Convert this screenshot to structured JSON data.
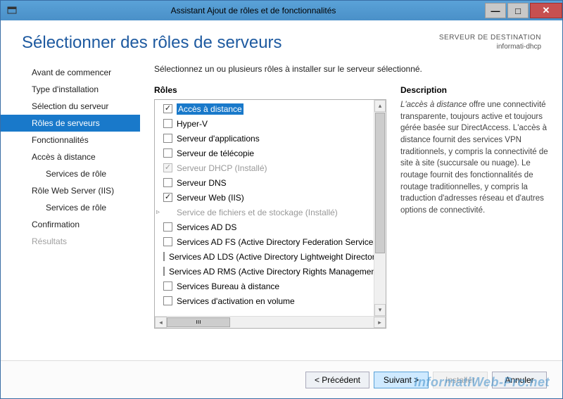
{
  "titlebar": {
    "title": "Assistant Ajout de rôles et de fonctionnalités"
  },
  "header": {
    "title": "Sélectionner des rôles de serveurs",
    "dest_label": "SERVEUR DE DESTINATION",
    "dest_value": "informati-dhcp"
  },
  "sidebar": {
    "items": [
      {
        "label": "Avant de commencer",
        "sub": false,
        "active": false,
        "disabled": false
      },
      {
        "label": "Type d'installation",
        "sub": false,
        "active": false,
        "disabled": false
      },
      {
        "label": "Sélection du serveur",
        "sub": false,
        "active": false,
        "disabled": false
      },
      {
        "label": "Rôles de serveurs",
        "sub": false,
        "active": true,
        "disabled": false
      },
      {
        "label": "Fonctionnalités",
        "sub": false,
        "active": false,
        "disabled": false
      },
      {
        "label": "Accès à distance",
        "sub": false,
        "active": false,
        "disabled": false
      },
      {
        "label": "Services de rôle",
        "sub": true,
        "active": false,
        "disabled": false
      },
      {
        "label": "Rôle Web Server (IIS)",
        "sub": false,
        "active": false,
        "disabled": false
      },
      {
        "label": "Services de rôle",
        "sub": true,
        "active": false,
        "disabled": false
      },
      {
        "label": "Confirmation",
        "sub": false,
        "active": false,
        "disabled": false
      },
      {
        "label": "Résultats",
        "sub": false,
        "active": false,
        "disabled": true
      }
    ]
  },
  "main": {
    "instruction": "Sélectionnez un ou plusieurs rôles à installer sur le serveur sélectionné.",
    "roles_label": "Rôles",
    "desc_label": "Description",
    "roles": [
      {
        "label": "Accès à distance",
        "checked": true,
        "disabled": false,
        "selected": true,
        "expand": false
      },
      {
        "label": "Hyper-V",
        "checked": false,
        "disabled": false,
        "selected": false,
        "expand": false
      },
      {
        "label": "Serveur d'applications",
        "checked": false,
        "disabled": false,
        "selected": false,
        "expand": false
      },
      {
        "label": "Serveur de télécopie",
        "checked": false,
        "disabled": false,
        "selected": false,
        "expand": false
      },
      {
        "label": "Serveur DHCP (Installé)",
        "checked": true,
        "disabled": true,
        "selected": false,
        "expand": false
      },
      {
        "label": "Serveur DNS",
        "checked": false,
        "disabled": false,
        "selected": false,
        "expand": false
      },
      {
        "label": "Serveur Web (IIS)",
        "checked": true,
        "disabled": false,
        "selected": false,
        "expand": false
      },
      {
        "label": "Service de fichiers et de stockage (Installé)",
        "checked": false,
        "disabled": true,
        "selected": false,
        "expand": true
      },
      {
        "label": "Services AD DS",
        "checked": false,
        "disabled": false,
        "selected": false,
        "expand": false
      },
      {
        "label": "Services AD FS (Active Directory Federation Services)",
        "checked": false,
        "disabled": false,
        "selected": false,
        "expand": false
      },
      {
        "label": "Services AD LDS (Active Directory Lightweight Directory Services)",
        "checked": false,
        "disabled": false,
        "selected": false,
        "expand": false
      },
      {
        "label": "Services AD RMS (Active Directory Rights Management Services)",
        "checked": false,
        "disabled": false,
        "selected": false,
        "expand": false
      },
      {
        "label": "Services Bureau à distance",
        "checked": false,
        "disabled": false,
        "selected": false,
        "expand": false
      },
      {
        "label": "Services d'activation en volume",
        "checked": false,
        "disabled": false,
        "selected": false,
        "expand": false
      }
    ],
    "description": {
      "lead": "L'accès à distance",
      "rest": " offre une connectivité transparente, toujours active et toujours gérée basée sur DirectAccess. L'accès à distance fournit des services VPN traditionnels, y compris la connectivité de site à site (succursale ou nuage). Le routage fournit des fonctionnalités de routage traditionnelles, y compris la traduction d'adresses réseau et d'autres options de connectivité."
    }
  },
  "footer": {
    "prev": "< Précédent",
    "next": "Suivant >",
    "install": "Installer",
    "cancel": "Annuler"
  },
  "watermark": "InformatiWeb-Pro.net"
}
